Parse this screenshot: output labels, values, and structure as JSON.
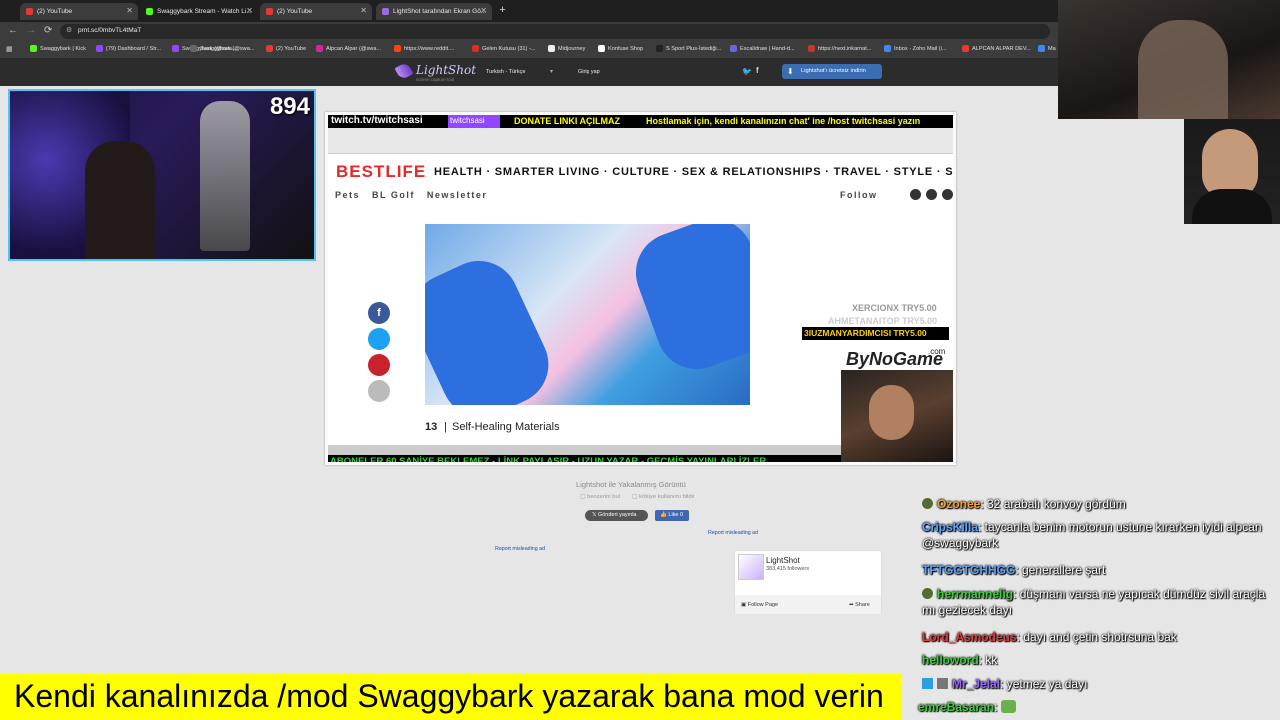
{
  "tabs": [
    {
      "title": "(2) YouTube",
      "color": "#e53935",
      "active": true
    },
    {
      "title": "Swaggybark Stream - Watch Li...",
      "color": "#53fc18",
      "active": false
    },
    {
      "title": "(2) YouTube",
      "color": "#e53935",
      "active": false
    },
    {
      "title": "LightShot tarafından Ekran Gö...",
      "color": "#9c6ade",
      "active": true
    }
  ],
  "new_tab": "+",
  "address": "prnt.sc/0mbvTL4tMaT",
  "bookmarks": [
    "Swaggybark | Kick",
    "(79) Dashboard / Str...",
    "Swaggybark (@swa...",
    "Swaggybark (@swa...",
    "(2) YouTube",
    "Alpcan Alpar (@swa...",
    "https://www.reddit....",
    "Gelen Kutusu (31) -...",
    "Midjourney",
    "Konfuse Shop",
    "S Sport Plus-İstediği...",
    "Excalidraw | Hand-d...",
    "https://next.inkarnat...",
    "Inbox - Zoho Mail (i...",
    "ALPCAN ALPAR DEV...",
    "Ma"
  ],
  "lightshot": {
    "logo": "LightShot",
    "tagline": "screen capture tool",
    "language": "Turkish - Türkçe",
    "login": "Giriş yap",
    "download": "Lightshot'ı ücretsiz indirin"
  },
  "cam_counter": "894",
  "screenshot": {
    "ticker_top_prefix": "twitch.tv/twitchsasi",
    "ticker_top_badge": "twitchsasi",
    "ticker_top_text": "DONATE LINKI AÇILMAZ",
    "ticker_top_text2": "Hostlamak için, kendi kanalınızın chat' ine /host twitchsasi yazın",
    "brand": "BESTLIFE",
    "nav": "HEALTH · SMARTER LIVING · CULTURE · SEX & RELATIONSHIPS · TRAVEL · STYLE · SHOP",
    "subnav": "Pets   BL Golf   Newsletter",
    "follow": "Follow",
    "caption_num": "13",
    "caption": "Self-Healing Materials",
    "donor1": "XERCIONX TRY5.00",
    "donor2": "AHMETANAITOP TRY5.00",
    "donor3": "3IUZMANYARDIMCISI TRY5.00",
    "sponsor": "ByNoGame",
    "sponsor_dot": ".com",
    "ticker_bottom": "ABONELER 60 SANİYE BEKLEMEZ - LİNK PAYLAŞIR - UZUN YAZAR - GEÇMİŞ YAYINLARI İZLER"
  },
  "page": {
    "title": "Lightshot ile Yakalanmış Görüntü",
    "similar": "benzerini bul",
    "misuse": "kötüye kullanımı bildir",
    "tweet": "Gönderi yayınla",
    "like": "Like 0",
    "report1": "Report misleading ad",
    "report2": "Report misleading ad",
    "fb_name": "LightShot",
    "fb_followers": "383,415 followers",
    "fb_follow": "Follow Page",
    "fb_share": "Share"
  },
  "chat": [
    {
      "user": "Ozonee",
      "color": "#f0a030",
      "text": ": 32 arabalı konvoy gördüm",
      "badge": true
    },
    {
      "user": "CripsKilla",
      "color": "#5aa0ff",
      "text": ": taycanla benim motorun ustune kırarken iyidi alpcan @swaggybark",
      "badge": false
    },
    {
      "user": "TFTGGTGHHGG",
      "color": "#5aa0ff",
      "text": ": generallere şart",
      "badge": false
    },
    {
      "user": "herrmannelig",
      "color": "#3cd03c",
      "text": ": düşmanı varsa ne yapıcak dümdüz sivil araçla mı geziecek dayı",
      "badge": true
    },
    {
      "user": "Lord_Asmodeus",
      "color": "#e03c3c",
      "text": ": dayı and çetin shotrsuna bak",
      "badge": false
    },
    {
      "user": "helloword",
      "color": "#3cd03c",
      "text": ": kk",
      "badge": false
    },
    {
      "user": "Mr_Jelal",
      "color": "#9a6aff",
      "text": ": yetmez ya dayı",
      "badge": true
    },
    {
      "user": "emreBasaran",
      "color": "#3cd03c",
      "text": ":",
      "badge": false
    }
  ],
  "banner": "Kendi kanalınızda /mod Swaggybark yazarak bana mod verin"
}
